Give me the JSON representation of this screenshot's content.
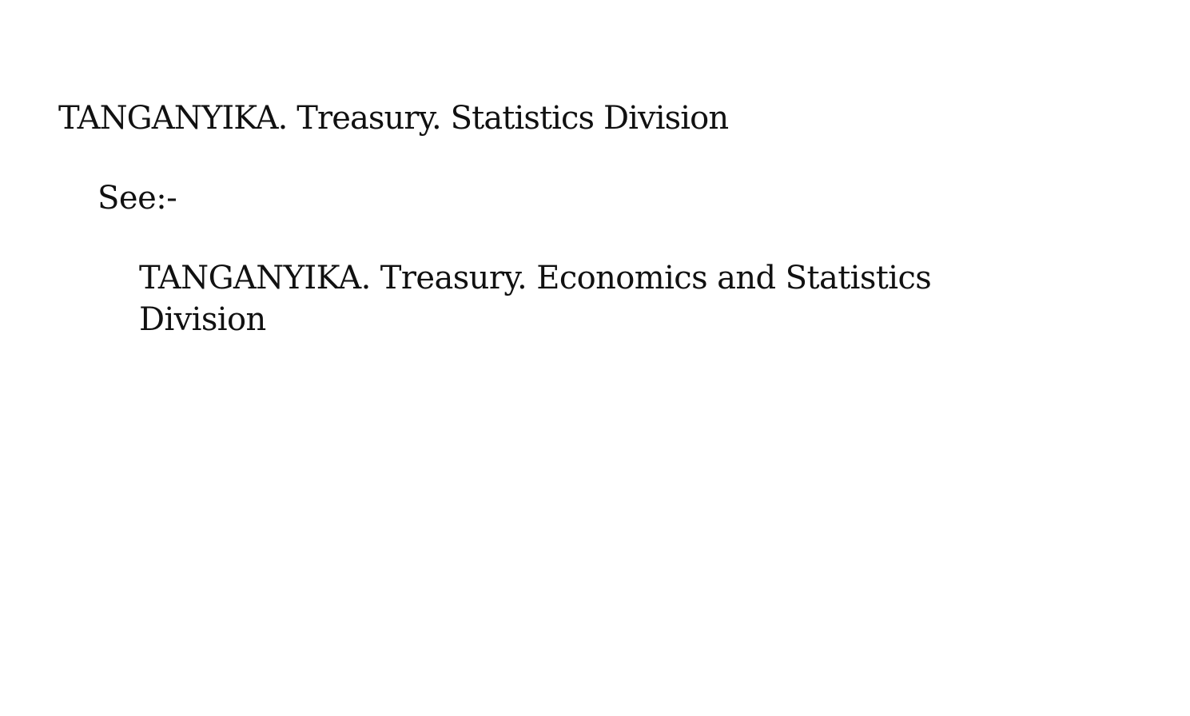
{
  "card": {
    "heading": "TANGANYIKA. Treasury. Statistics Division",
    "see_label": "See:-",
    "reference_line_1": "TANGANYIKA. Treasury. Economics and Statistics",
    "reference_line_2": "Division"
  },
  "colors": {
    "background": "#ffffff",
    "ink": "#111111"
  }
}
